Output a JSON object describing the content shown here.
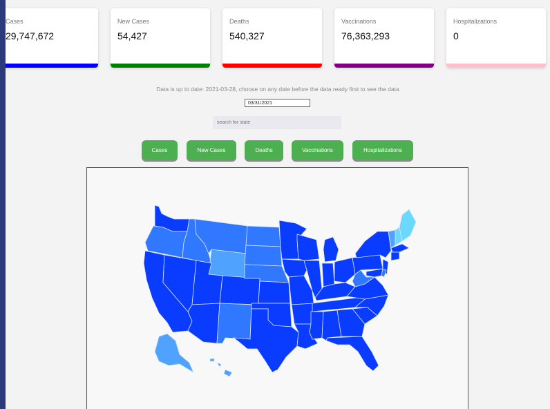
{
  "cards": [
    {
      "label": "Cases",
      "value": "29,747,672",
      "color": "#0000ff"
    },
    {
      "label": "New Cases",
      "value": "54,427",
      "color": "#008000"
    },
    {
      "label": "Deaths",
      "value": "540,327",
      "color": "#ff0000"
    },
    {
      "label": "Vaccinations",
      "value": "76,363,293",
      "color": "#800080"
    },
    {
      "label": "Hospitalizations",
      "value": "0",
      "color": "#ffc0cb"
    }
  ],
  "info_text": "Data is up to date: 2021-03-28, choose on any date before the data ready first to see the data",
  "date_value": "03/31/2021",
  "search_placeholder": "search for state",
  "buttons": [
    "Cases",
    "New Cases",
    "Deaths",
    "Vaccinations",
    "Hospitalizations"
  ],
  "colors": {
    "dark": "#0a3cff",
    "mid": "#2f78ff",
    "light": "#4fa3ff",
    "lightest": "#6ad8ff",
    "border": "#cfe0ff"
  }
}
